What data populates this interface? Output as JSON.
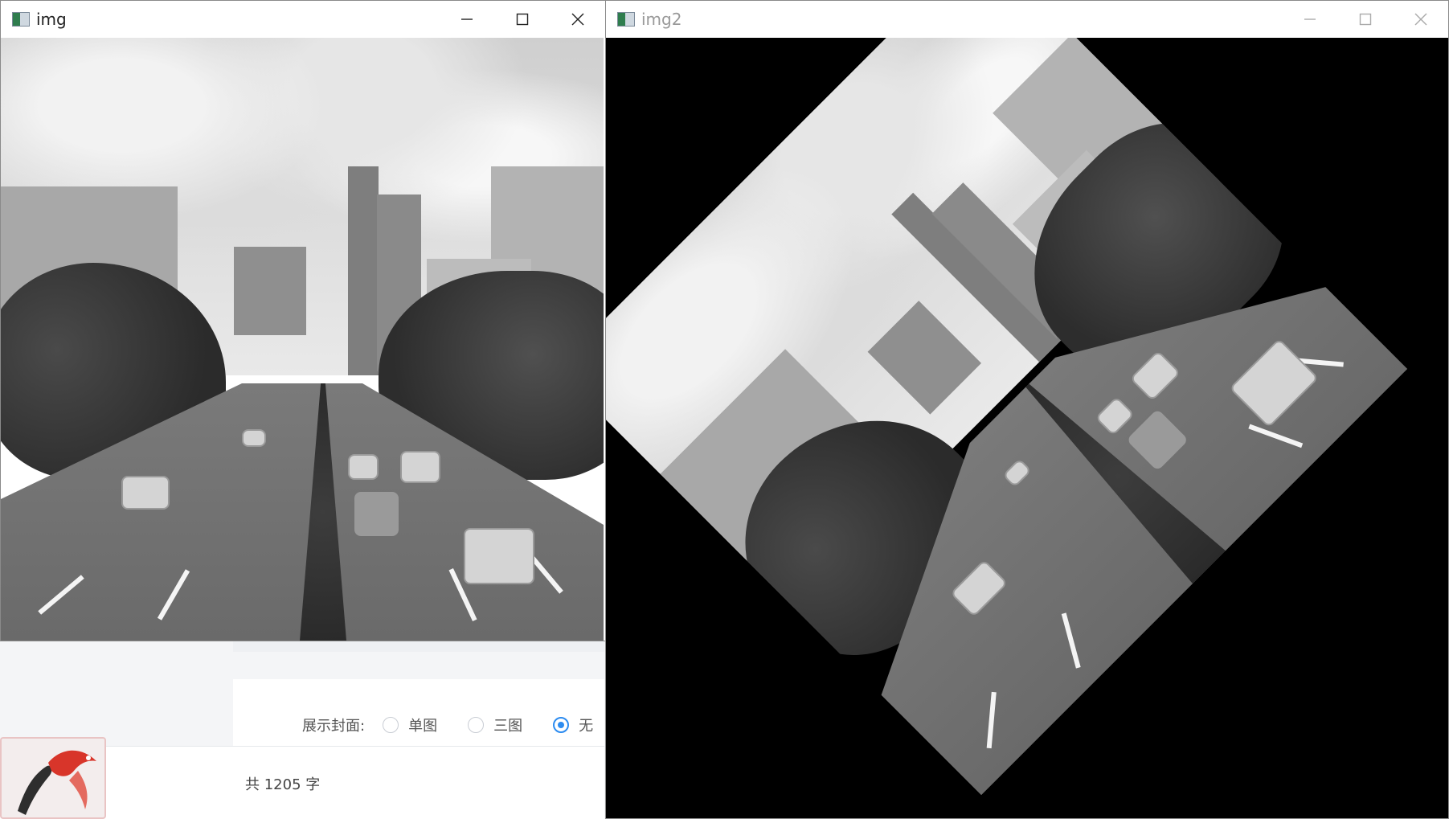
{
  "windows": {
    "img": {
      "title": "img"
    },
    "img2": {
      "title": "img2"
    }
  },
  "editor": {
    "cover_label": "展示封面:",
    "cover_options": [
      {
        "label": "单图",
        "checked": false
      },
      {
        "label": "三图",
        "checked": false
      },
      {
        "label": "无",
        "checked": true
      }
    ],
    "word_count": "共 1205 字"
  },
  "colors": {
    "accent": "#2d8cf0",
    "close_hover": "#e81123"
  }
}
